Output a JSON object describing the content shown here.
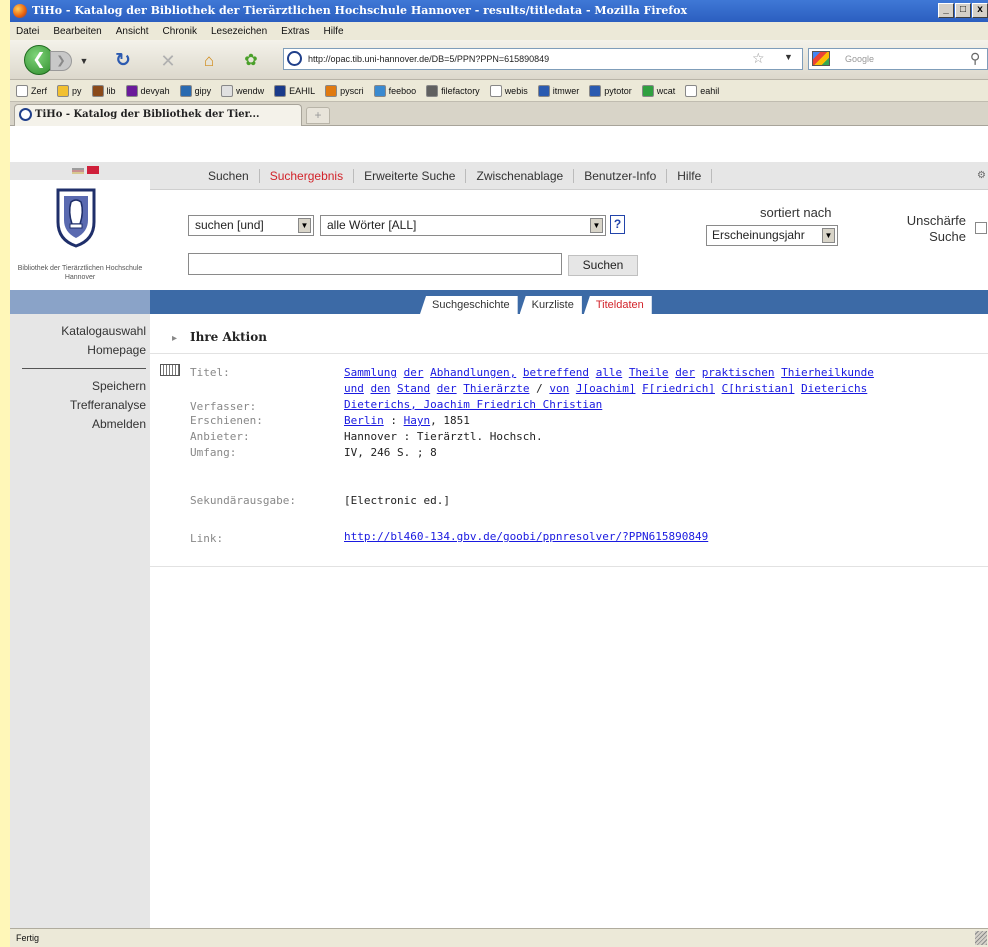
{
  "window": {
    "title": "TiHo - Katalog der Bibliothek der Tierärztlichen Hochschule Hannover - results/titledata - Mozilla Firefox",
    "buttons": [
      "_",
      "□",
      "x"
    ]
  },
  "menu": [
    "Datei",
    "Bearbeiten",
    "Ansicht",
    "Chronik",
    "Lesezeichen",
    "Extras",
    "Hilfe"
  ],
  "toolbar": {
    "url": "http://opac.tib.uni-hannover.de/DB=5/PPN?PPN=615890849",
    "search_placeholder": "Google"
  },
  "bookmarks": [
    {
      "label": "Zerf",
      "color": "#ffffff"
    },
    {
      "label": "py",
      "color": "#f2c030"
    },
    {
      "label": "lib",
      "color": "#8a4a1a"
    },
    {
      "label": "devyah",
      "color": "#6a1a9a"
    },
    {
      "label": "gipy",
      "color": "#2a6ab0"
    },
    {
      "label": "wendw",
      "color": "#e0e0e0"
    },
    {
      "label": "EAHIL",
      "color": "#1a3a8a"
    },
    {
      "label": "pyscri",
      "color": "#e07a10"
    },
    {
      "label": "feeboo",
      "color": "#3a8ad0"
    },
    {
      "label": "filefactory",
      "color": "#606060"
    },
    {
      "label": "webis",
      "color": "#ffffff"
    },
    {
      "label": "itmwer",
      "color": "#2a5ab0"
    },
    {
      "label": "pytotor",
      "color": "#2a5ab0"
    },
    {
      "label": "wcat",
      "color": "#30a040"
    },
    {
      "label": "eahil",
      "color": "#ffffff"
    }
  ],
  "tab": {
    "title": "TiHo - Katalog der Bibliothek der Tier...",
    "new_tab": "+"
  },
  "site": {
    "logo_text": "Bibliothek der Tierärztlichen Hochschule Hannover",
    "topnav": [
      "Suchen",
      "Suchergebnis",
      "Erweiterte Suche",
      "Zwischenablage",
      "Benutzer-Info",
      "Hilfe"
    ],
    "topnav_active": "Suchergebnis",
    "search": {
      "mode": "suchen [und]",
      "index": "alle Wörter [ALL]",
      "help": "?",
      "sort_label": "sortiert nach",
      "sort_value": "Erscheinungsjahr",
      "fuzzy_label_1": "Unschärfe",
      "fuzzy_label_2": "Suche",
      "query": "",
      "button": "Suchen"
    },
    "subtabs": [
      "Suchgeschichte",
      "Kurzliste",
      "Titeldaten"
    ],
    "subtab_active": "Titeldaten",
    "leftnav_top": [
      "Katalogauswahl",
      "Homepage"
    ],
    "leftnav_bottom": [
      "Speichern",
      "Trefferanalyse",
      "Abmelden"
    ],
    "action_title": "Ihre Aktion"
  },
  "record": {
    "titel_label": "Titel:",
    "titel_words_line1": [
      "Sammlung",
      "der",
      "Abhandlungen,",
      "betreffend",
      "alle",
      "Theile",
      "der",
      "praktischen",
      "Thierheilkunde"
    ],
    "titel_words_line2": [
      "und",
      "den",
      "Stand",
      "der",
      "Thierärzte"
    ],
    "titel_sep": "/",
    "titel_von": "von",
    "titel_authors": [
      "J[oachim]",
      "F[riedrich]",
      "C[hristian]",
      "Dieterichs"
    ],
    "verfasser_label": "Verfasser:",
    "verfasser": "Dieterichs, Joachim Friedrich Christian",
    "erschienen_label": "Erschienen:",
    "erschienen_place": "Berlin",
    "erschienen_sep": ":",
    "erschienen_pub": "Hayn",
    "erschienen_year": ", 1851",
    "anbieter_label": "Anbieter:",
    "anbieter": "Hannover : Tierärztl. Hochsch.",
    "umfang_label": "Umfang:",
    "umfang": "IV, 246 S. ; 8",
    "sekundaer_label": "Sekundärausgabe:",
    "sekundaer": "[Electronic ed.]",
    "link_label": "Link:",
    "link": "http://bl460-134.gbv.de/goobi/ppnresolver/?PPN615890849"
  },
  "status": "Fertig"
}
